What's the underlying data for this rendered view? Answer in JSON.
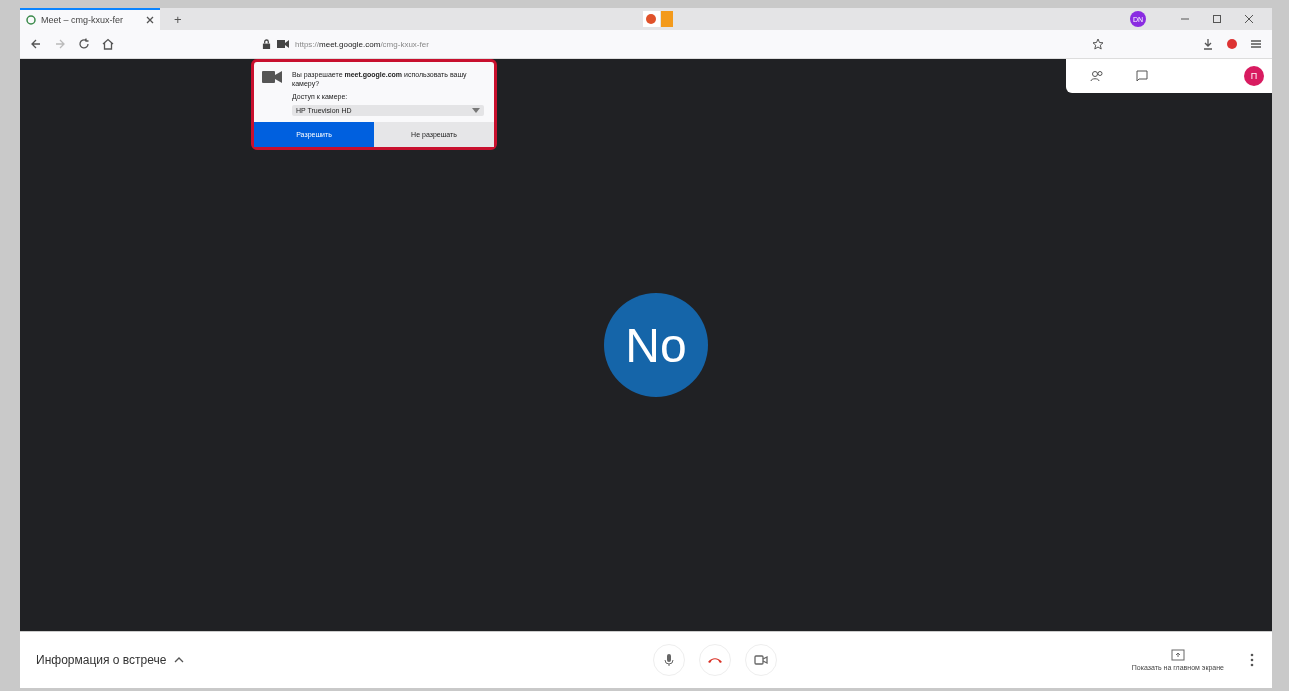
{
  "browser": {
    "tab": {
      "title": "Meet – cmg-kxux-fer",
      "selected": true
    },
    "new_tab": "+",
    "url": {
      "host": "meet.google.com",
      "prefix": "https://",
      "path": "/cmg-kxux-fer"
    },
    "profile": "DN"
  },
  "permission_dialog": {
    "text": "Вы разрешаете **meet.google.com** использовать вашу камеру?",
    "device_label": "Доступ к камере:",
    "device": "HP Truevision HD",
    "buttons": [
      {
        "label": "Разрешить",
        "selected": true
      },
      {
        "label": "Не разрешать",
        "selected": false
      }
    ]
  },
  "meeting": {
    "participant_initials": "No",
    "user_initials": "П"
  },
  "bottom_bar": {
    "info": "Информация о встрече",
    "present": "Показать на главном экране"
  }
}
